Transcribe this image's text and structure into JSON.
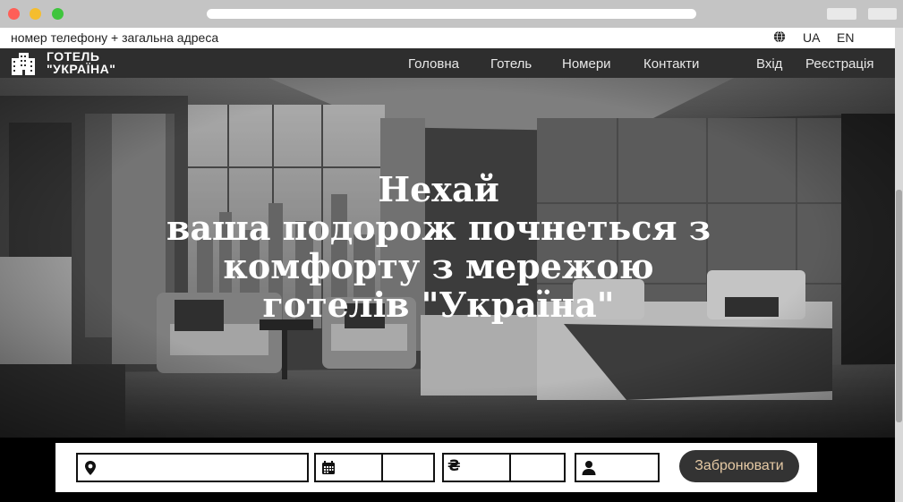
{
  "infobar": {
    "contact_text": "номер телефону + загальна адреса",
    "lang_ua": "UA",
    "lang_en": "EN"
  },
  "nav": {
    "logo_line1": "ГОТЕЛЬ",
    "logo_line2": "\"УКРАЇНА\"",
    "links": [
      "Головна",
      "Готель",
      "Номери",
      "Контакти"
    ],
    "login": "Вхід",
    "register": "Реєстрація"
  },
  "hero": {
    "title_lines": [
      "Нехай",
      "ваша подорож почнеться з",
      "комфорту з мережою",
      "готелів \"Україна\""
    ]
  },
  "booking": {
    "location_value": "",
    "date_from": "",
    "date_to": "",
    "price_from": "",
    "price_to": "",
    "guests": "",
    "submit_label": "Забронювати"
  },
  "colors": {
    "nav_bg": "#2e2e2e",
    "button_bg": "#333333",
    "button_text": "#e5c9a4"
  }
}
